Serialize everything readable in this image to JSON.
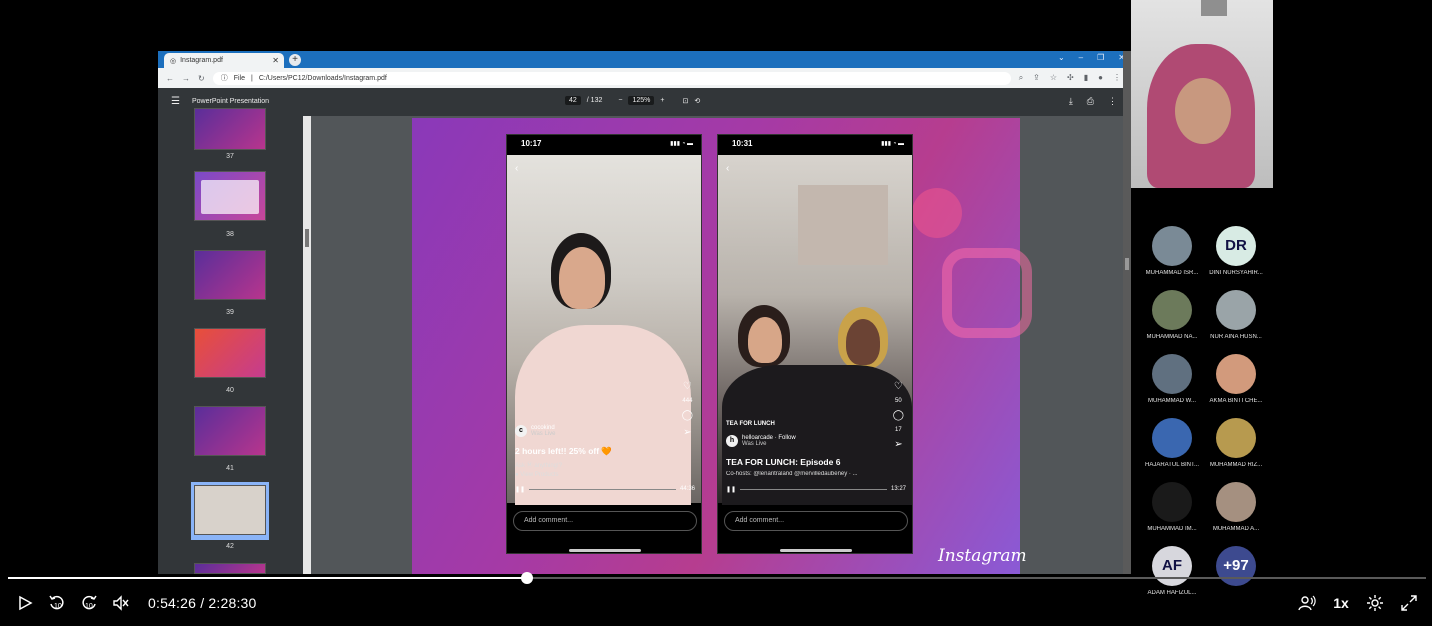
{
  "browser": {
    "tab_title": "Instagram.pdf",
    "address_prefix": "File",
    "address": "C:/Users/PC12/Downloads/Instagram.pdf"
  },
  "pdf": {
    "title": "PowerPoint Presentation",
    "current_page": "42",
    "total_pages": "/ 132",
    "zoom": "125%"
  },
  "thumbnails": [
    {
      "num": "37"
    },
    {
      "num": "38"
    },
    {
      "num": "39"
    },
    {
      "num": "40"
    },
    {
      "num": "41"
    },
    {
      "num": "42"
    }
  ],
  "slide": {
    "brand": "Instagram",
    "phone1": {
      "time": "10:17",
      "account": "cocokind",
      "status": "Was Live",
      "caption": "2 hours left!! 25% off 🧡",
      "sub": "Ask Ⓜ anything!?",
      "products": "View Products",
      "duration": "44:36",
      "likes": "444",
      "comment_placeholder": "Add comment..."
    },
    "phone2": {
      "time": "10:31",
      "tag": "TEA FOR LUNCH",
      "account": "helloarcade",
      "follow": "Follow",
      "status": "Was Live",
      "caption": "TEA FOR LUNCH: Episode 6",
      "sub": "Co-hosts: @lenaritraland @mervilledaubeney · ...",
      "duration": "13:27",
      "likes": "50",
      "comments": "17",
      "comment_placeholder": "Add comment..."
    }
  },
  "participants": [
    {
      "name": "MUHAMMAD ISR...",
      "initials": "",
      "color": "#7a8a96"
    },
    {
      "name": "DINI NURSYAHIR...",
      "initials": "DR",
      "color": "#d8ebe4"
    },
    {
      "name": "MUHAMMAD NA...",
      "initials": "",
      "color": "#6c7a5b"
    },
    {
      "name": "NUR AINA HUSN...",
      "initials": "",
      "color": "#9aa4a8"
    },
    {
      "name": "MUHAMMAD W...",
      "initials": "",
      "color": "#607080"
    },
    {
      "name": "AKMA BINTI CHE...",
      "initials": "",
      "color": "#d29a7c"
    },
    {
      "name": "HAJARATUL BINT...",
      "initials": "",
      "color": "#3a67b0"
    },
    {
      "name": "MUHAMMAD RIZ...",
      "initials": "",
      "color": "#b79a4f"
    },
    {
      "name": "MUHAMMAD IM...",
      "initials": "",
      "color": "#1a1a1a"
    },
    {
      "name": "MUHAMMAD A...",
      "initials": "",
      "color": "#a59080"
    },
    {
      "name": "ADAM HAFIZUL...",
      "initials": "AF",
      "color": "#d7d7dd"
    },
    {
      "name": "",
      "initials": "+97",
      "color": "#3d4a8f"
    }
  ],
  "player": {
    "current_time": "0:54:26",
    "separator": "/",
    "total_time": "2:28:30",
    "progress_fraction": 0.366,
    "speed": "1x"
  }
}
